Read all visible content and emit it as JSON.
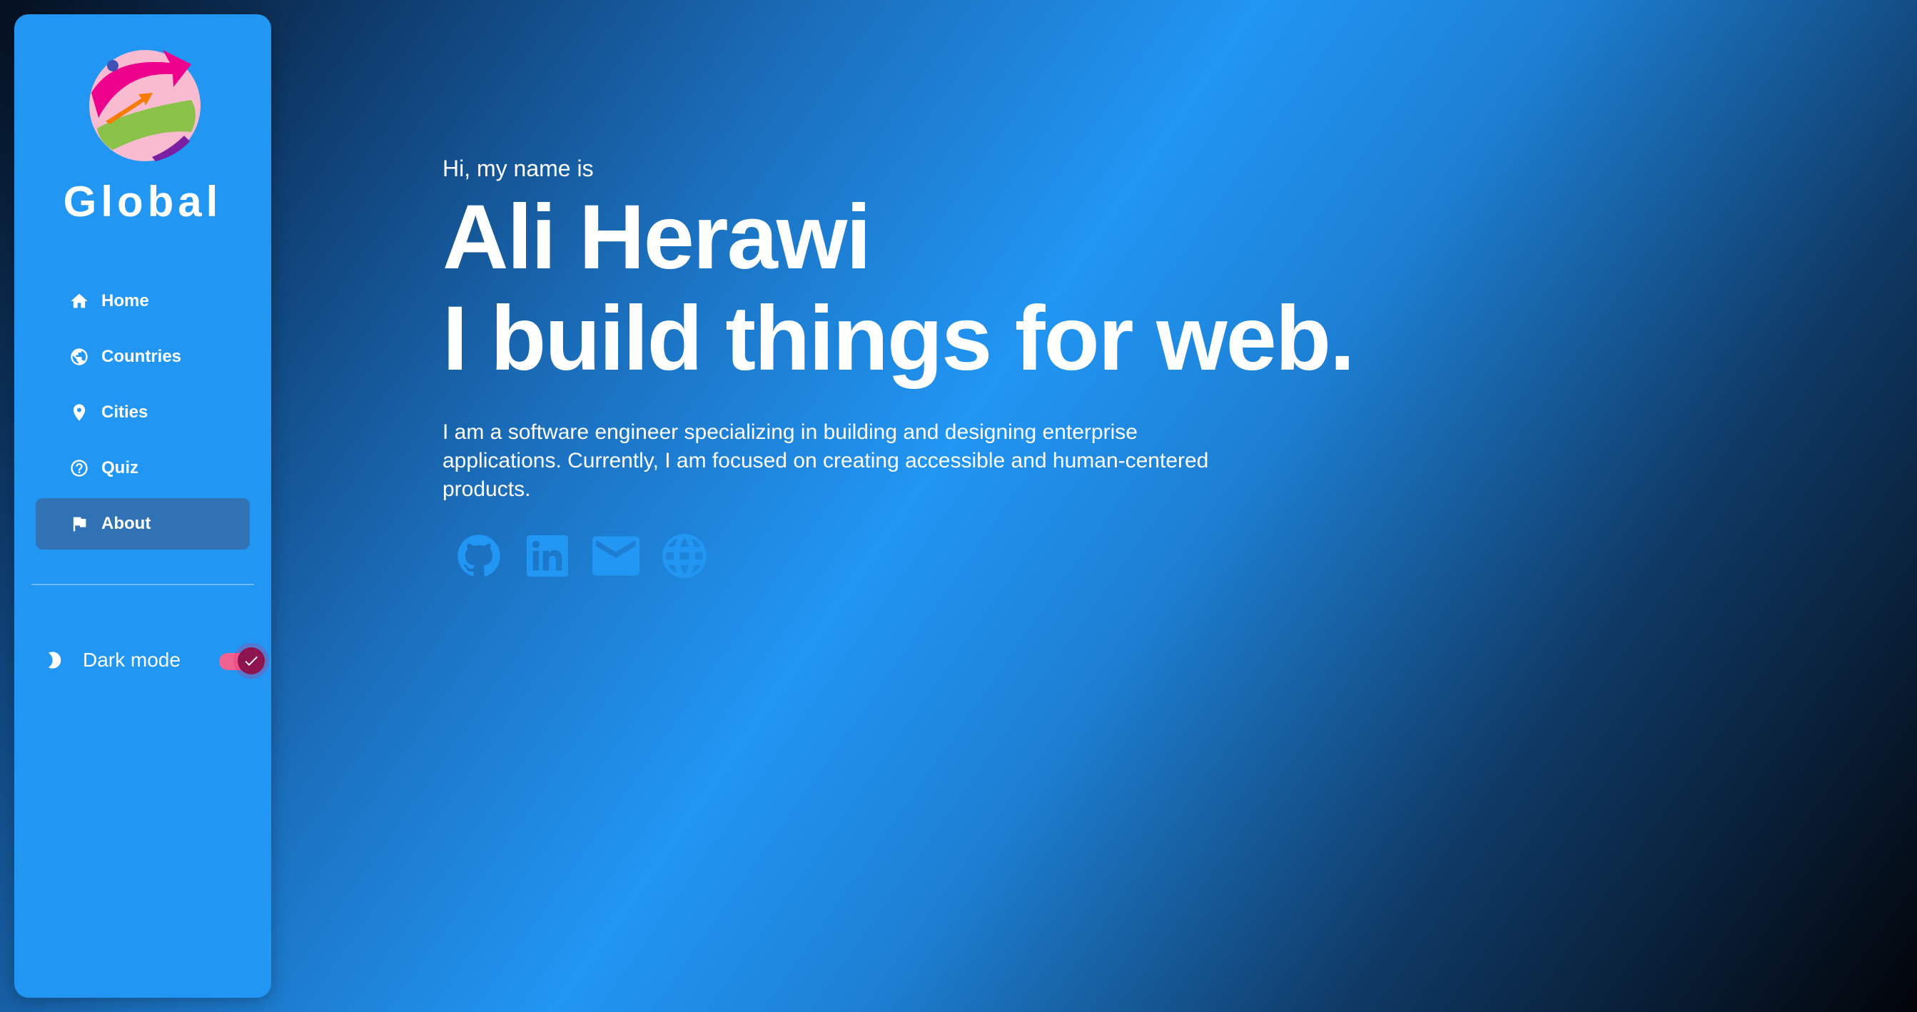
{
  "sidebar": {
    "brand": "Global",
    "nav": [
      {
        "label": "Home",
        "icon": "home-icon"
      },
      {
        "label": "Countries",
        "icon": "globe-icon"
      },
      {
        "label": "Cities",
        "icon": "location-pin-icon"
      },
      {
        "label": "Quiz",
        "icon": "help-circle-icon"
      },
      {
        "label": "About",
        "icon": "flag-icon",
        "active": true
      }
    ],
    "dark_mode": {
      "label": "Dark mode",
      "enabled": true
    }
  },
  "hero": {
    "greeting": "Hi, my name is",
    "name": "Ali Herawi",
    "tagline": "I build things for web.",
    "bio": "I am a software engineer specializing in building and designing enterprise applications. Currently, I am focused on creating accessible and human-centered products.",
    "social": [
      "github-icon",
      "linkedin-icon",
      "email-icon",
      "website-icon"
    ]
  },
  "colors": {
    "sidebar": "#2196f3",
    "active_item": "#3072b4",
    "switch_track": "#f06292",
    "switch_thumb": "#8e1450",
    "social_icons": "#2196f3"
  }
}
